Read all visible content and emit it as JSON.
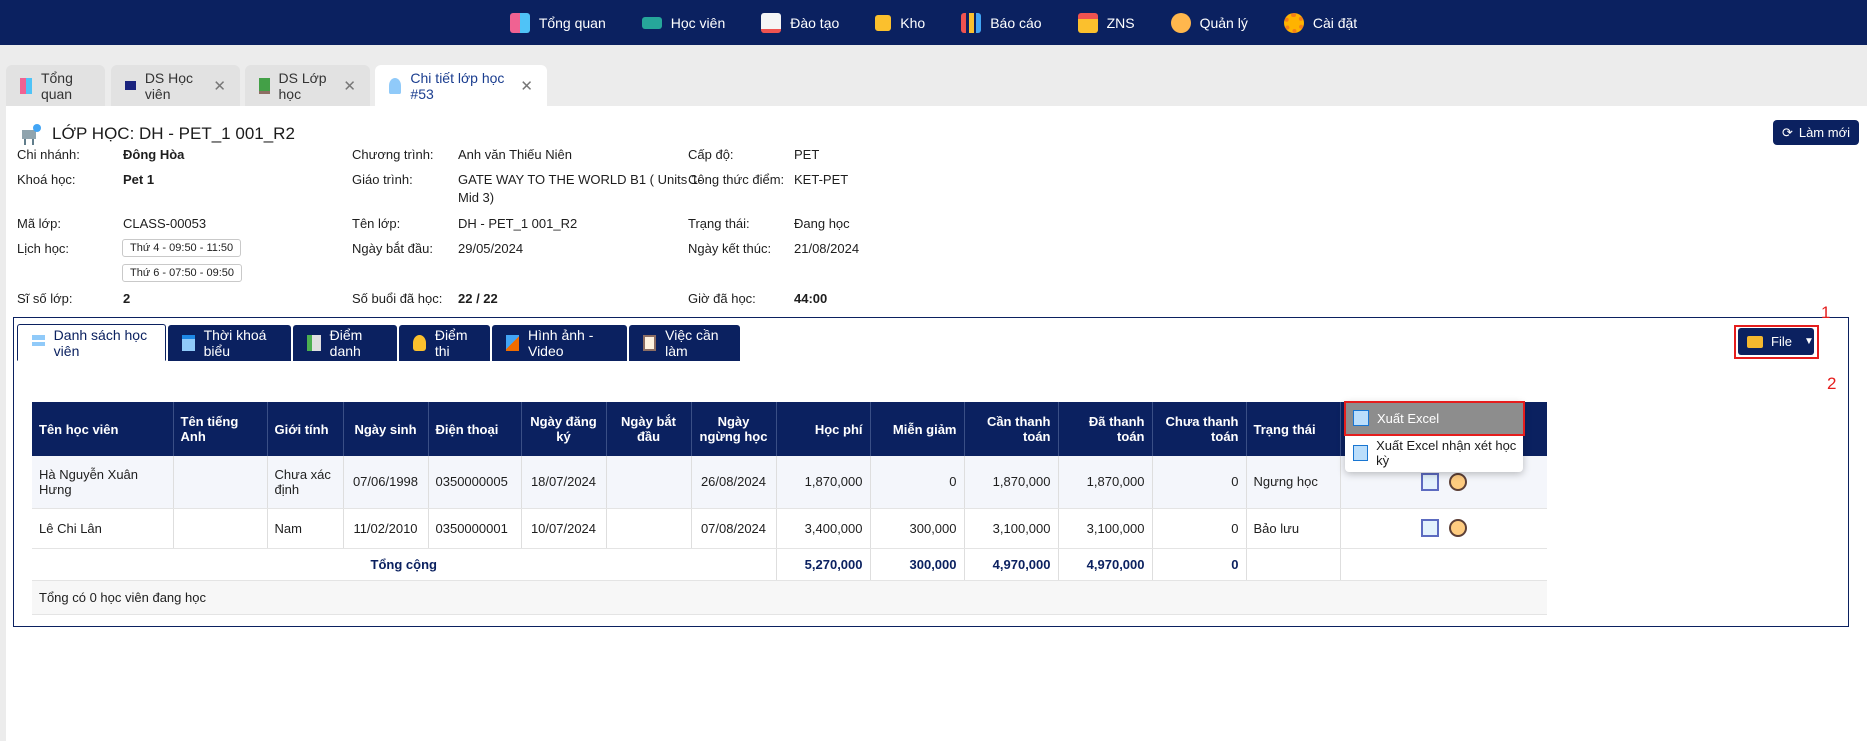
{
  "nav": [
    {
      "label": "Tổng quan",
      "icon": "dashboard-icon"
    },
    {
      "label": "Học viên",
      "icon": "student-cap-icon"
    },
    {
      "label": "Đào tạo",
      "icon": "teacher-icon"
    },
    {
      "label": "Kho",
      "icon": "box-icon"
    },
    {
      "label": "Báo cáo",
      "icon": "chart-icon"
    },
    {
      "label": "ZNS",
      "icon": "mail-icon"
    },
    {
      "label": "Quản lý",
      "icon": "gear-manage-icon"
    },
    {
      "label": "Cài đặt",
      "icon": "gear-icon"
    }
  ],
  "tabs": [
    {
      "label": "Tổng quan"
    },
    {
      "label": "DS Học viên"
    },
    {
      "label": "DS Lớp học"
    },
    {
      "label": "Chi tiết lớp học #53"
    }
  ],
  "page": {
    "title": "LỚP HỌC: DH - PET_1 001_R2",
    "refresh_label": "Làm mới"
  },
  "info": {
    "branch_label": "Chi nhánh:",
    "branch": "Đông Hòa",
    "course_label": "Khoá học:",
    "course": "Pet 1",
    "code_label": "Mã lớp:",
    "code": "CLASS-00053",
    "schedule_label": "Lịch học:",
    "schedule": [
      "Thứ 4 - 09:50 - 11:50",
      "Thứ 6 - 07:50 - 09:50"
    ],
    "size_label": "Sĩ số lớp:",
    "size": "2",
    "program_label": "Chương trình:",
    "program": "Anh văn Thiếu Niên",
    "syllabus_label": "Giáo trình:",
    "syllabus_line1": "GATE WAY TO THE WORLD B1 ( Units 1-",
    "syllabus_line2": "Mid 3)",
    "class_name_label": "Tên lớp:",
    "class_name": "DH - PET_1 001_R2",
    "start_label": "Ngày bắt đầu:",
    "start": "29/05/2024",
    "sessions_label": "Số buổi đã học:",
    "sessions": "22 / 22",
    "level_label": "Cấp độ:",
    "level": "PET",
    "formula_label": "Công thức điểm:",
    "formula": "KET-PET",
    "status_label": "Trạng thái:",
    "status": "Đang học",
    "end_label": "Ngày kết thúc:",
    "end": "21/08/2024",
    "hours_label": "Giờ đã học:",
    "hours": "44:00"
  },
  "content_tabs": [
    {
      "label": "Danh sách học viên"
    },
    {
      "label": "Thời khoá biểu"
    },
    {
      "label": "Điểm danh"
    },
    {
      "label": "Điểm thi"
    },
    {
      "label": "Hình ảnh - Video"
    },
    {
      "label": "Việc cần làm"
    }
  ],
  "file_button": "File",
  "annotations": {
    "one": "1",
    "two": "2"
  },
  "dropdown": {
    "export_excel": "Xuất Excel",
    "export_review": "Xuất Excel nhận xét học kỳ"
  },
  "table": {
    "headers": [
      "Tên học viên",
      "Tên tiếng Anh",
      "Giới tính",
      "Ngày sinh",
      "Điện thoại",
      "Ngày đăng ký",
      "Ngày bắt đầu",
      "Ngày ngừng học",
      "Học phí",
      "Miễn giảm",
      "Cần thanh toán",
      "Đã thanh toán",
      "Chưa thanh toán",
      "Trạng thái"
    ],
    "rows": [
      {
        "name": "Hà Nguyễn Xuân Hưng",
        "en": "",
        "gender": "Chưa xác định",
        "dob": "07/06/1998",
        "phone": "0350000005",
        "reg": "18/07/2024",
        "start": "",
        "stop": "26/08/2024",
        "fee": "1,870,000",
        "discount": "0",
        "due": "1,870,000",
        "paid": "1,870,000",
        "unpaid": "0",
        "status": "Ngưng học"
      },
      {
        "name": "Lê Chi Lân",
        "en": "",
        "gender": "Nam",
        "dob": "11/02/2010",
        "phone": "0350000001",
        "reg": "10/07/2024",
        "start": "",
        "stop": "07/08/2024",
        "fee": "3,400,000",
        "discount": "300,000",
        "due": "3,100,000",
        "paid": "3,100,000",
        "unpaid": "0",
        "status": "Bảo lưu"
      }
    ],
    "total_label": "Tổng cộng",
    "totals": {
      "fee": "5,270,000",
      "discount": "300,000",
      "due": "4,970,000",
      "paid": "4,970,000",
      "unpaid": "0"
    },
    "footer": "Tổng có 0 học viên đang học"
  }
}
